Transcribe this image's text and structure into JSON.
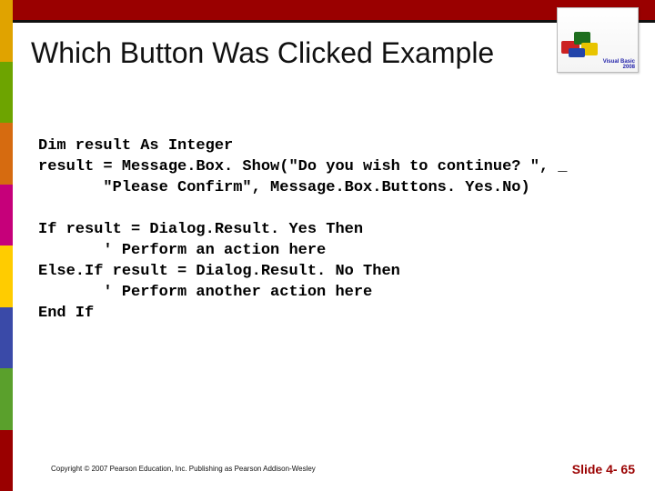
{
  "title": "Which Button Was Clicked Example",
  "code_block1": "Dim result As Integer\nresult = Message.Box. Show(\"Do you wish to continue? \", _\n       \"Please Confirm\", Message.Box.Buttons. Yes.No)",
  "code_block2": "If result = Dialog.Result. Yes Then\n       ' Perform an action here\nElse.If result = Dialog.Result. No Then\n       ' Perform another action here\nEnd If",
  "copyright": "Copyright © 2007 Pearson Education, Inc. Publishing as Pearson Addison-Wesley",
  "slide_number": "Slide 4- 65",
  "book": {
    "line1": "Visual Basic",
    "line2": "2008"
  }
}
